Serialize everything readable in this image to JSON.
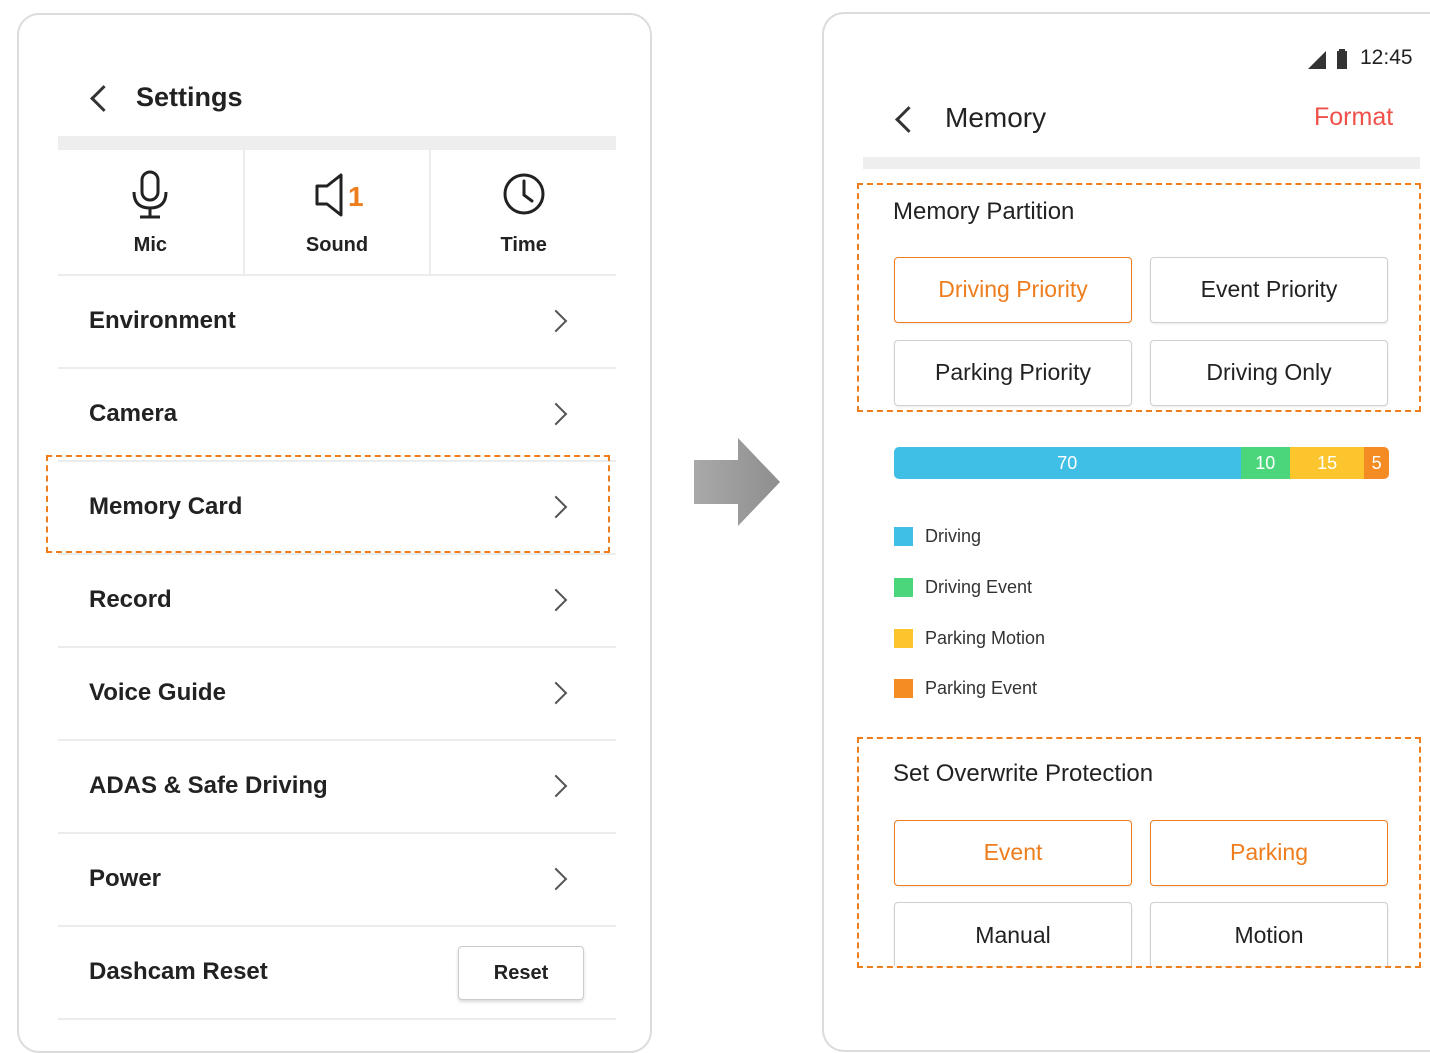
{
  "settings": {
    "title": "Settings",
    "quick": [
      {
        "icon": "microphone-icon",
        "label": "Mic"
      },
      {
        "icon": "speaker-icon",
        "label": "Sound",
        "badge": "1"
      },
      {
        "icon": "clock-icon",
        "label": "Time"
      }
    ],
    "menu": [
      {
        "label": "Environment"
      },
      {
        "label": "Camera"
      },
      {
        "label": "Memory Card"
      },
      {
        "label": "Record"
      },
      {
        "label": "Voice Guide"
      },
      {
        "label": "ADAS & Safe Driving"
      },
      {
        "label": "Power"
      },
      {
        "label": "Dashcam Reset",
        "button": "Reset"
      }
    ]
  },
  "memory": {
    "status_time": "12:45",
    "title": "Memory",
    "format_label": "Format",
    "partition_title": "Memory Partition",
    "partition_options": [
      "Driving Priority",
      "Event Priority",
      "Parking Priority",
      "Driving Only"
    ],
    "partition_selected": "Driving Priority",
    "usage": [
      {
        "label": "Driving",
        "value": 70,
        "color": "#3fbee6"
      },
      {
        "label": "Driving Event",
        "value": 10,
        "color": "#4cd67c"
      },
      {
        "label": "Parking Motion",
        "value": 15,
        "color": "#fcc52e"
      },
      {
        "label": "Parking Event",
        "value": 5,
        "color": "#f58b23"
      }
    ],
    "overwrite_title": "Set Overwrite Protection",
    "overwrite_options": [
      "Event",
      "Parking",
      "Manual",
      "Motion"
    ],
    "overwrite_selected": [
      "Event",
      "Parking"
    ]
  },
  "colors": {
    "accent": "#ee7d1e",
    "format": "#f0504a"
  }
}
